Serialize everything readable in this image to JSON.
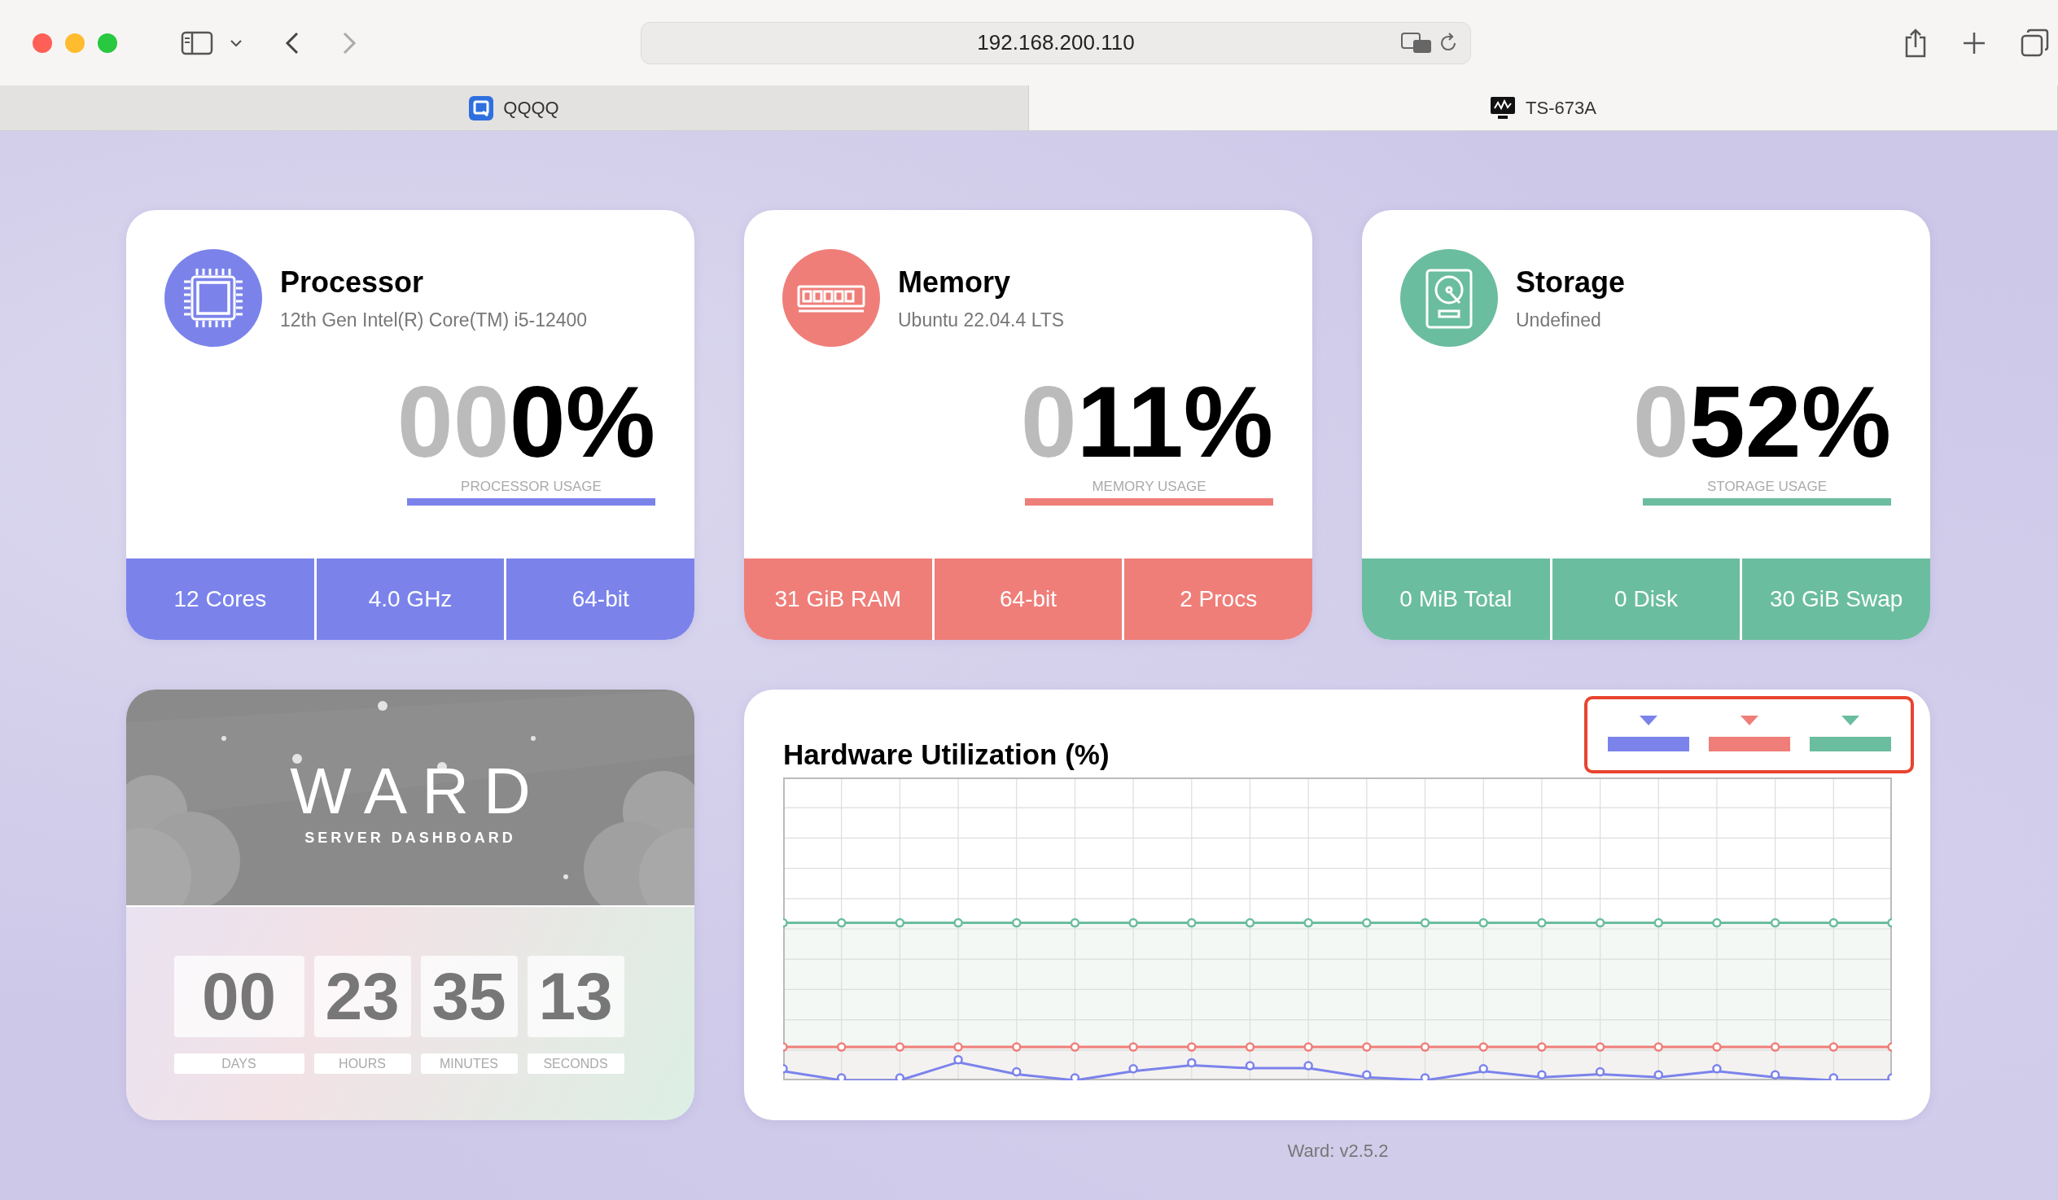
{
  "browser": {
    "address": "192.168.200.110",
    "tabs": [
      {
        "title": "QQQQ",
        "selected": false
      },
      {
        "title": "TS-673A",
        "selected": true
      }
    ]
  },
  "cards": [
    {
      "kind": "processor",
      "title": "Processor",
      "subtitle": "12th Gen Intel(R) Core(TM) i5-12400",
      "usage_dim": "00",
      "usage": "0%",
      "usage_label": "PROCESSOR USAGE",
      "color": "#7b83eb",
      "stats": [
        "12 Cores",
        "4.0 GHz",
        "64-bit"
      ]
    },
    {
      "kind": "memory",
      "title": "Memory",
      "subtitle": "Ubuntu 22.04.4 LTS",
      "usage_dim": "0",
      "usage": "11%",
      "usage_label": "MEMORY USAGE",
      "color": "#ef7e79",
      "stats": [
        "31 GiB RAM",
        "64-bit",
        "2 Procs"
      ]
    },
    {
      "kind": "storage",
      "title": "Storage",
      "subtitle": "Undefined",
      "usage_dim": "0",
      "usage": "52%",
      "usage_label": "STORAGE USAGE",
      "color": "#6bbd9f",
      "stats": [
        "0 MiB Total",
        "0 Disk",
        "30 GiB Swap"
      ]
    }
  ],
  "ward": {
    "title": "WARD",
    "subtitle": "SERVER DASHBOARD",
    "uptime": [
      {
        "value": "00",
        "label": "DAYS"
      },
      {
        "value": "23",
        "label": "HOURS"
      },
      {
        "value": "35",
        "label": "MINUTES"
      },
      {
        "value": "13",
        "label": "SECONDS"
      }
    ]
  },
  "chart": {
    "title": "Hardware Utilization (%)",
    "legend": [
      {
        "color": "#7b83eb"
      },
      {
        "color": "#ef7e79"
      },
      {
        "color": "#6bbd9f"
      }
    ]
  },
  "footer": "Ward: v2.5.2"
}
